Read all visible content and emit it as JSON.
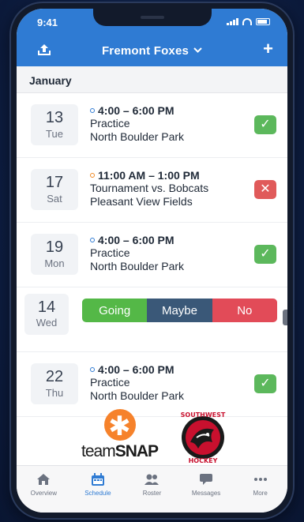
{
  "status_bar": {
    "time": "9:41"
  },
  "header": {
    "title": "Fremont Foxes",
    "upload_icon": "upload-icon",
    "add_icon": "plus-icon"
  },
  "month": "January",
  "events": [
    {
      "day": "13",
      "weekday": "Tue",
      "time": "4:00 – 6:00 PM",
      "title": "Practice",
      "location": "North Boulder Park",
      "rsvp": "going"
    },
    {
      "day": "17",
      "weekday": "Sat",
      "time": "11:00 AM – 1:00 PM",
      "title": "Tournament vs. Bobcats",
      "location": "Pleasant View Fields",
      "rsvp": "no"
    },
    {
      "day": "19",
      "weekday": "Mon",
      "time": "4:00 – 6:00 PM",
      "title": "Practice",
      "location": "North Boulder Park",
      "rsvp": "going"
    }
  ],
  "swipe_event": {
    "day": "14",
    "weekday": "Wed",
    "options": [
      "Going",
      "Maybe",
      "No"
    ]
  },
  "last_event": {
    "day": "22",
    "weekday": "Thu",
    "time": "4:00 – 6:00 PM",
    "title": "Practice",
    "location": "North Boulder Park",
    "rsvp": "going"
  },
  "brands": {
    "teamsnap": {
      "pre": "team",
      "post": "SNAP"
    },
    "southwest": {
      "top": "SOUTHWEST",
      "bottom": "HOCKEY"
    }
  },
  "tabs": [
    {
      "label": "Overview",
      "icon": "home-icon"
    },
    {
      "label": "Schedule",
      "icon": "calendar-icon"
    },
    {
      "label": "Roster",
      "icon": "people-icon"
    },
    {
      "label": "Messages",
      "icon": "chat-icon"
    },
    {
      "label": "More",
      "icon": "more-icon"
    }
  ],
  "colors": {
    "brand_blue": "#2f7bd3",
    "going": "#54b847",
    "maybe": "#3a5878",
    "no": "#e24b58"
  }
}
